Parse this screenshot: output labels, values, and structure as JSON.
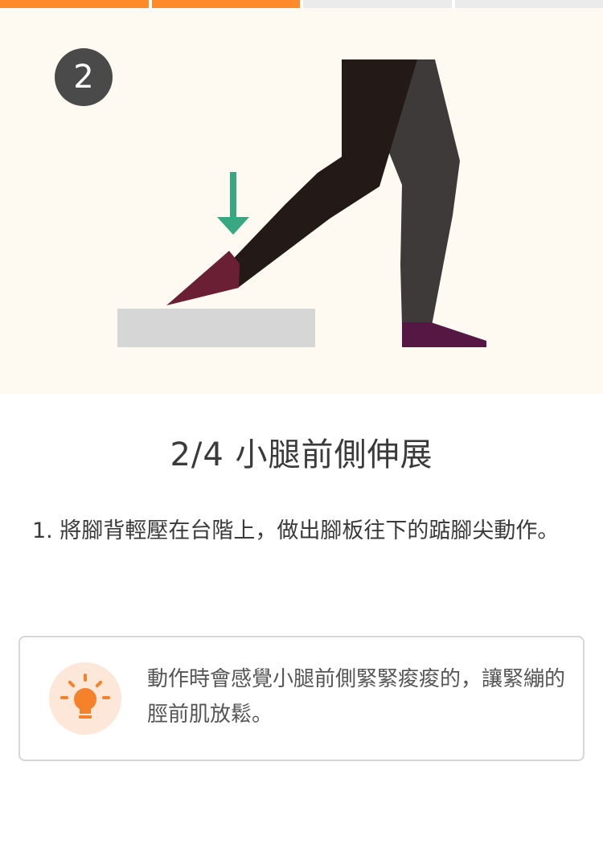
{
  "progress": {
    "total": 4,
    "completed": 2,
    "active_color": "#ff8a2a",
    "inactive_color": "#ebebeb"
  },
  "step": {
    "number": "2"
  },
  "exercise": {
    "title": "2/4 小腿前側伸展",
    "instruction": "1. 將腳背輕壓在台階上，做出腳板往下的踮腳尖動作。"
  },
  "tip": {
    "icon": "lightbulb-icon",
    "text": "動作時會感覺小腿前側緊緊痠痠的，讓緊繃的脛前肌放鬆。",
    "accent_color": "#f5822a"
  },
  "illustration": {
    "arrow_color": "#3aa783",
    "front_leg_color": "#231a17",
    "back_leg_color": "#3d3a39",
    "front_sock_color": "#6b1f35",
    "back_sock_color": "#571745",
    "step_color": "#d6d6d6",
    "background_color": "#fffaf1"
  }
}
